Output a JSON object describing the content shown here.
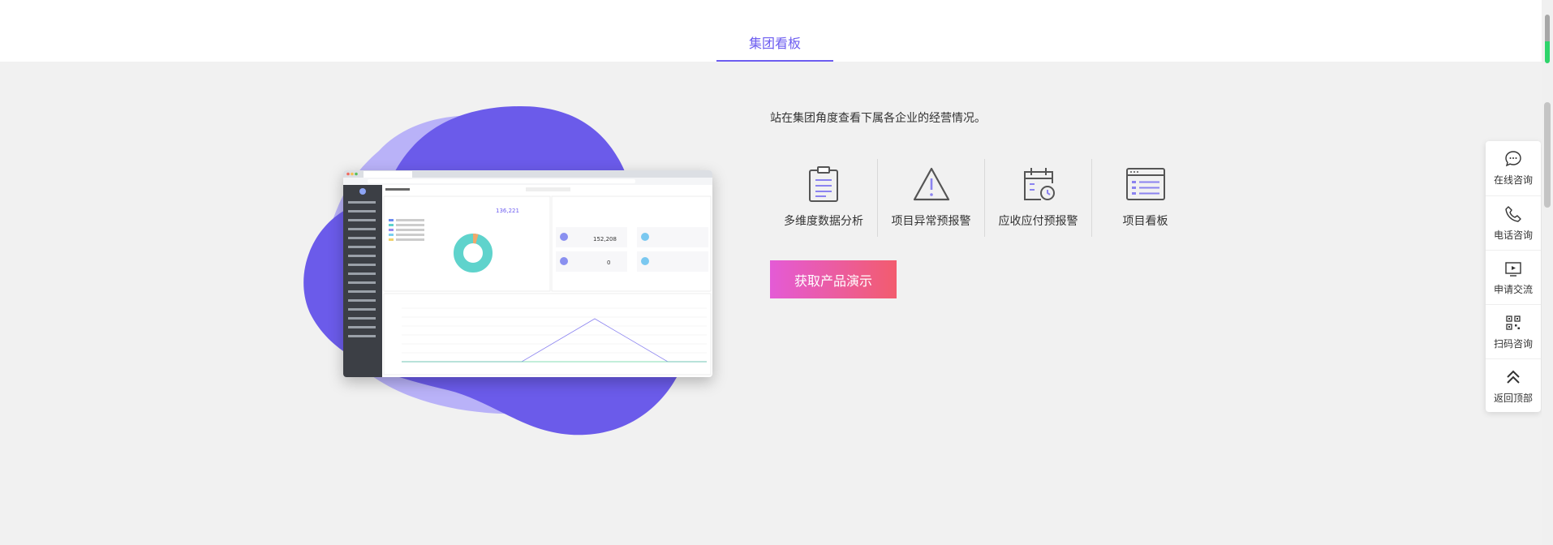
{
  "tabs": {
    "active_label": "集团看板"
  },
  "main": {
    "description": "站在集团角度查看下属各企业的经营情况。",
    "features": [
      {
        "label": "多维度数据分析",
        "icon": "clipboard-icon"
      },
      {
        "label": "项目异常预报警",
        "icon": "warning-icon"
      },
      {
        "label": "应收应付预报警",
        "icon": "calendar-refresh-icon"
      },
      {
        "label": "项目看板",
        "icon": "browser-window-icon"
      }
    ],
    "cta_label": "获取产品演示"
  },
  "float_panel": {
    "items": [
      {
        "label": "在线咨询",
        "icon": "chat-bubble-icon"
      },
      {
        "label": "电话咨询",
        "icon": "phone-icon"
      },
      {
        "label": "申请交流",
        "icon": "play-screen-icon"
      },
      {
        "label": "扫码咨询",
        "icon": "qr-code-icon"
      },
      {
        "label": "返回顶部",
        "icon": "double-chevron-up-icon"
      }
    ]
  },
  "mini_dashboard": {
    "value_1": "136,221",
    "value_2": "152,208",
    "value_3": "0"
  },
  "colors": {
    "accent": "#6d5df0",
    "blob_dark": "#6b5bea",
    "blob_light": "#b9b2f8",
    "cta_start": "#e45bd6",
    "cta_end": "#f25c6e",
    "donut": "#5fd3cc"
  }
}
